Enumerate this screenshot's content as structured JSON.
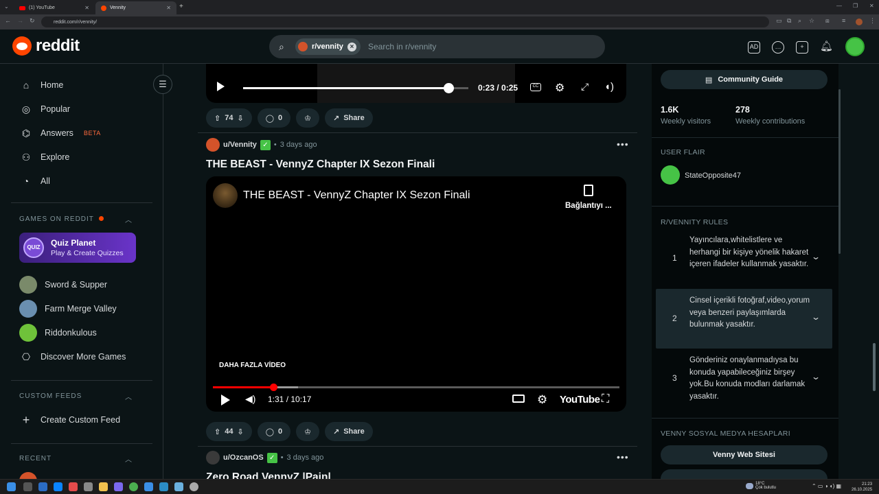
{
  "browser": {
    "tabs": [
      {
        "label": "(1) YouTube",
        "icon": "youtube-icon",
        "active": false
      },
      {
        "label": "Vennity",
        "icon": "reddit-icon",
        "active": true
      }
    ],
    "url": "reddit.com/r/vennity/"
  },
  "header": {
    "logo_text": "reddit",
    "search": {
      "chip_label": "r/vennity",
      "placeholder": "Search in r/vennity"
    }
  },
  "sidebar": {
    "nav": [
      {
        "label": "Home",
        "icon": "home-icon"
      },
      {
        "label": "Popular",
        "icon": "popular-icon"
      },
      {
        "label": "Answers",
        "icon": "answers-icon",
        "badge": "BETA"
      },
      {
        "label": "Explore",
        "icon": "explore-icon"
      },
      {
        "label": "All",
        "icon": "all-icon"
      }
    ],
    "games_title": "GAMES ON REDDIT",
    "quiz": {
      "logo": "QUIZ",
      "title": "Quiz Planet",
      "subtitle": "Play & Create Quizzes"
    },
    "games": [
      {
        "label": "Sword & Supper",
        "color": "#7a8a6a"
      },
      {
        "label": "Farm Merge Valley",
        "color": "#6a8fb0"
      },
      {
        "label": "Riddonkulous",
        "color": "#6fc23a"
      }
    ],
    "discover_label": "Discover More Games",
    "custom_feeds_title": "CUSTOM FEEDS",
    "create_feed_label": "Create Custom Feed",
    "recent_title": "RECENT"
  },
  "feed": {
    "top_video": {
      "time": "0:23 / 0:25"
    },
    "post1_actions": {
      "votes": "74",
      "comments": "0",
      "share": "Share"
    },
    "post2": {
      "user": "u/Vennity",
      "time": "3 days ago",
      "title": "THE BEAST - VennyZ Chapter IX Sezon Finali",
      "embed": {
        "title": "THE BEAST - VennyZ Chapter IX Sezon Finali",
        "copy_label": "Bağlantıyı ...",
        "more_videos": "DAHA FAZLA VİDEO",
        "time": "1:31 / 10:17",
        "logo": "YouTube",
        "progress": 0.149
      },
      "actions": {
        "votes": "44",
        "comments": "0",
        "share": "Share"
      }
    },
    "post3": {
      "user": "u/OzcanOS",
      "time": "3 days ago",
      "title": "Zero Road VennyZ |Pain|"
    }
  },
  "right": {
    "guide_label": "Community Guide",
    "stats": [
      {
        "value": "1.6K",
        "label": "Weekly visitors"
      },
      {
        "value": "278",
        "label": "Weekly contributions"
      }
    ],
    "user_flair_title": "USER FLAIR",
    "flair_user": "StateOpposite47",
    "rules_title": "R/VENNITY RULES",
    "rules": [
      {
        "num": "1",
        "text": "Yayıncılara,whitelistlere ve herhangi bir kişiye yönelik hakaret içeren ifadeler kullanmak yasaktır."
      },
      {
        "num": "2",
        "text": "Cinsel içerikli fotoğraf,video,yorum veya benzeri paylaşımlarda bulunmak yasaktır."
      },
      {
        "num": "3",
        "text": "Gönderiniz onaylanmadıysa bu konuda yapabileceğiniz birşey yok.Bu konuda modları darlamak yasaktır."
      }
    ],
    "social_title": "VENNY SOSYAL MEDYA HESAPLARI",
    "links": [
      "Venny Web Sitesi"
    ]
  },
  "taskbar": {
    "weather_temp": "18°C",
    "weather_desc": "Çok bulutlu",
    "time": "21:23",
    "date": "26.10.2025"
  }
}
